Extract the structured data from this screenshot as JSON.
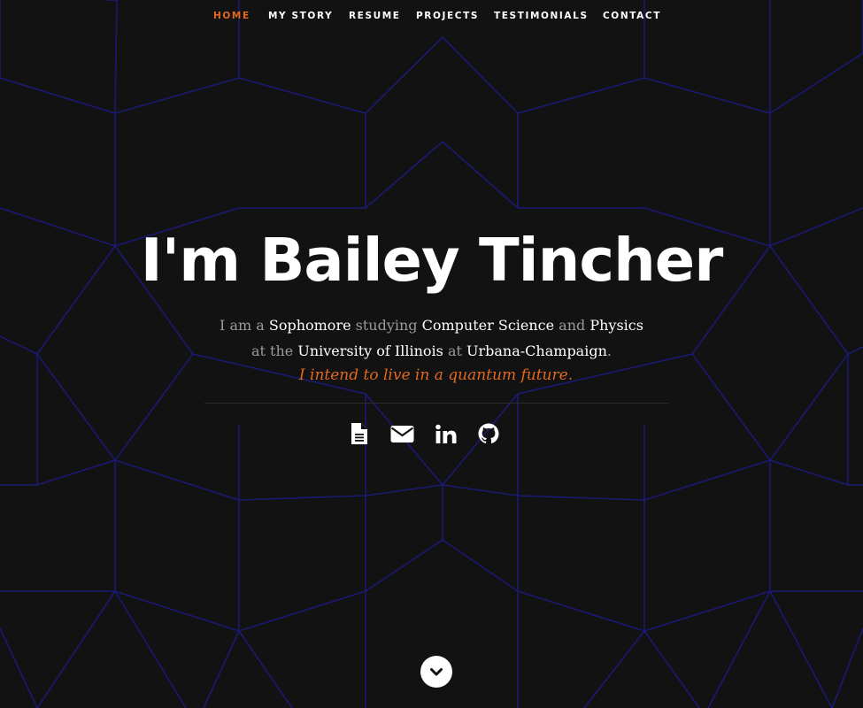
{
  "nav": {
    "items": [
      {
        "label": "HOME",
        "active": true
      },
      {
        "label": "MY STORY",
        "active": false
      },
      {
        "label": "RESUME",
        "active": false
      },
      {
        "label": "PROJECTS",
        "active": false
      },
      {
        "label": "TESTIMONIALS",
        "active": false
      },
      {
        "label": "CONTACT",
        "active": false
      }
    ]
  },
  "hero": {
    "title": "I'm Bailey Tincher",
    "bio": {
      "line1": {
        "t1": "I am a ",
        "h1": "Sophomore",
        "t2": " studying ",
        "h2": "Computer Science",
        "t3": " and ",
        "h3": "Physics"
      },
      "line2": {
        "t1": "at the ",
        "h1": "University of Illinois",
        "t2": " at ",
        "h2": "Urbana-Champaign",
        "t3": "."
      }
    },
    "tagline": "I intend to live in a quantum future."
  },
  "social": [
    {
      "icon": "resume-file-icon"
    },
    {
      "icon": "email-envelope-icon"
    },
    {
      "icon": "linkedin-icon"
    },
    {
      "icon": "github-icon"
    }
  ],
  "scroll": {
    "icon": "chevron-down-icon"
  },
  "colors": {
    "background": "#121213",
    "accent": "#e2691f",
    "pattern": "#1a1a72",
    "text": "#ffffff",
    "muted": "#9a9a9a"
  }
}
